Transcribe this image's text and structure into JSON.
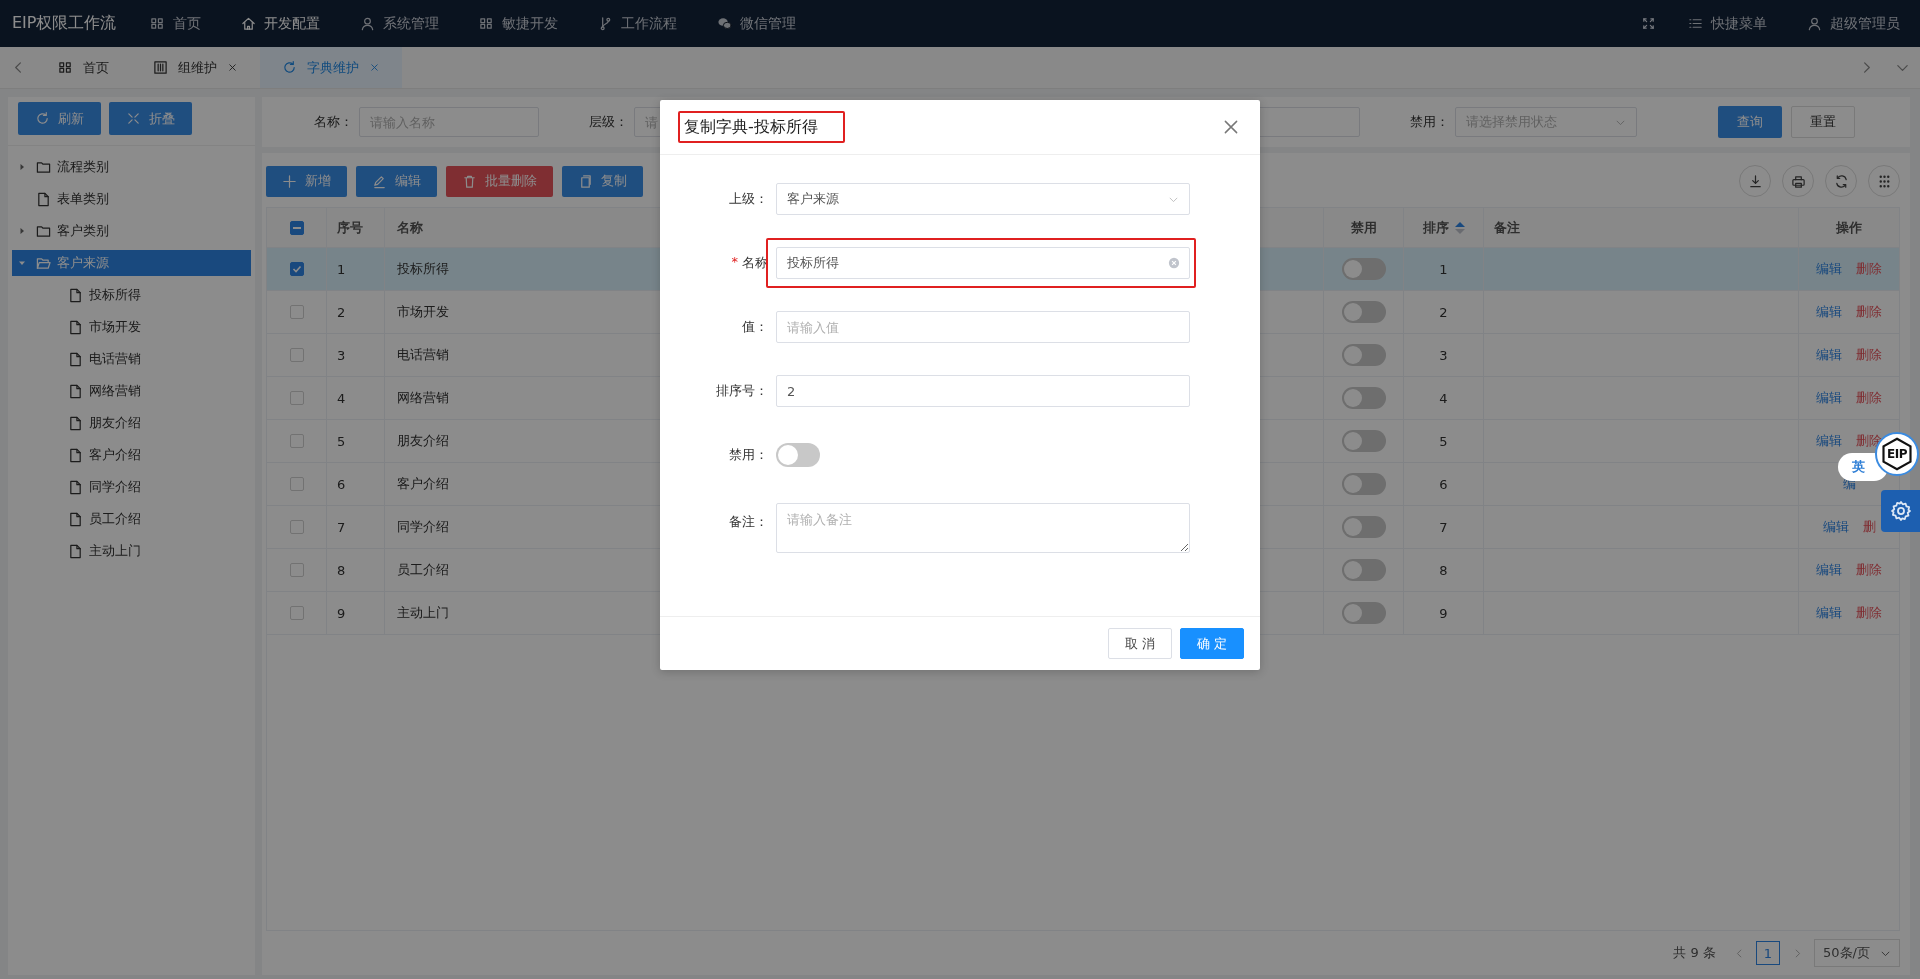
{
  "top_nav": {
    "brand": "EIP权限工作流",
    "items": [
      {
        "label": "首页",
        "selected": false
      },
      {
        "label": "开发配置",
        "selected": true
      },
      {
        "label": "系统管理",
        "selected": false
      },
      {
        "label": "敏捷开发",
        "selected": false
      },
      {
        "label": "工作流程",
        "selected": false
      },
      {
        "label": "微信管理",
        "selected": false
      }
    ],
    "quick_menu": "快捷菜单",
    "user": "超级管理员"
  },
  "tabs": [
    {
      "label": "首页",
      "selected": false,
      "closable": false
    },
    {
      "label": "组维护",
      "selected": false,
      "closable": true
    },
    {
      "label": "字典维护",
      "selected": true,
      "closable": true
    }
  ],
  "sidebar": {
    "buttons": [
      "刷新",
      "折叠"
    ],
    "tree": [
      {
        "label": "流程类别",
        "kind": "folder",
        "expanded": false,
        "selected": false
      },
      {
        "label": "表单类别",
        "kind": "file",
        "selected": false
      },
      {
        "label": "客户类别",
        "kind": "folder",
        "expanded": false,
        "selected": false
      },
      {
        "label": "客户来源",
        "kind": "folder",
        "expanded": true,
        "selected": true,
        "children": [
          {
            "label": "投标所得",
            "kind": "file",
            "selected": false
          },
          {
            "label": "市场开发",
            "kind": "file",
            "selected": false
          },
          {
            "label": "电话营销",
            "kind": "file",
            "selected": false
          },
          {
            "label": "网络营销",
            "kind": "file",
            "selected": false
          },
          {
            "label": "朋友介绍",
            "kind": "file",
            "selected": false
          },
          {
            "label": "客户介绍",
            "kind": "file",
            "selected": false
          },
          {
            "label": "同学介绍",
            "kind": "file",
            "selected": false
          },
          {
            "label": "员工介绍",
            "kind": "file",
            "selected": false
          },
          {
            "label": "主动上门",
            "kind": "file",
            "selected": false
          }
        ]
      }
    ]
  },
  "search": {
    "fields": [
      {
        "label": "名称：",
        "placeholder": "请输入名称",
        "kind": "input"
      },
      {
        "label": "层级：",
        "placeholder": "请",
        "kind": "input"
      },
      {
        "label": "禁用：",
        "placeholder": "请选择禁用状态",
        "kind": "select"
      }
    ],
    "buttons": [
      "查询",
      "重置"
    ]
  },
  "toolbar": [
    {
      "label": "新增",
      "kind": "add"
    },
    {
      "label": "编辑",
      "kind": "edit"
    },
    {
      "label": "批量删除",
      "kind": "delete"
    },
    {
      "label": "复制",
      "kind": "copy"
    }
  ],
  "table": {
    "select_all": {
      "indeterminate": true
    },
    "columns": [
      {
        "label": "序号"
      },
      {
        "label": "名称"
      },
      {
        "label": "禁用"
      },
      {
        "label": "排序",
        "sort_ascending": true
      },
      {
        "label": "备注"
      },
      {
        "label": "操作"
      }
    ],
    "rows": [
      {
        "selected": true,
        "no": "1",
        "name": "投标所得",
        "disabled": false,
        "sort": "1",
        "actions": [
          "编辑",
          "删除"
        ]
      },
      {
        "selected": false,
        "no": "2",
        "name": "市场开发",
        "disabled": false,
        "sort": "2",
        "actions": [
          "编辑",
          "删除"
        ]
      },
      {
        "selected": false,
        "no": "3",
        "name": "电话营销",
        "disabled": false,
        "sort": "3",
        "actions": [
          "编辑",
          "删除"
        ]
      },
      {
        "selected": false,
        "no": "4",
        "name": "网络营销",
        "disabled": false,
        "sort": "4",
        "actions": [
          "编辑",
          "删除"
        ]
      },
      {
        "selected": false,
        "no": "5",
        "name": "朋友介绍",
        "disabled": false,
        "sort": "5",
        "actions": [
          "编辑",
          "删除"
        ]
      },
      {
        "selected": false,
        "no": "6",
        "name": "客户介绍",
        "disabled": false,
        "sort": "6",
        "actions": [
          "编"
        ]
      },
      {
        "selected": false,
        "no": "7",
        "name": "同学介绍",
        "disabled": false,
        "sort": "7",
        "actions": [
          "编辑",
          "删"
        ]
      },
      {
        "selected": false,
        "no": "8",
        "name": "员工介绍",
        "disabled": false,
        "sort": "8",
        "actions": [
          "编辑",
          "删除"
        ]
      },
      {
        "selected": false,
        "no": "9",
        "name": "主动上门",
        "disabled": false,
        "sort": "9",
        "actions": [
          "编辑",
          "删除"
        ]
      }
    ]
  },
  "pagination": {
    "total": "共 9 条",
    "page": "1",
    "page_size": "50条/页"
  },
  "float_widget": {
    "lang": "英",
    "logo": "EIP"
  },
  "modal": {
    "title": "复制字典-投标所得",
    "title_highlighted": true,
    "fields": [
      {
        "kind": "select",
        "label": "上级：",
        "value": "客户来源"
      },
      {
        "kind": "input",
        "label": "名称",
        "value": "投标所得",
        "required_mark": "*",
        "clearable": true,
        "highlighted": true
      },
      {
        "kind": "input",
        "label": "值：",
        "placeholder": "请输入值"
      },
      {
        "kind": "input",
        "label": "排序号：",
        "value": "2"
      },
      {
        "kind": "switch",
        "label": "禁用：",
        "on": false
      },
      {
        "kind": "textarea",
        "label": "备注：",
        "placeholder": "请输入备注"
      }
    ],
    "buttons": [
      {
        "label": "取 消",
        "kind": "default"
      },
      {
        "label": "确 定",
        "kind": "primary"
      }
    ]
  }
}
